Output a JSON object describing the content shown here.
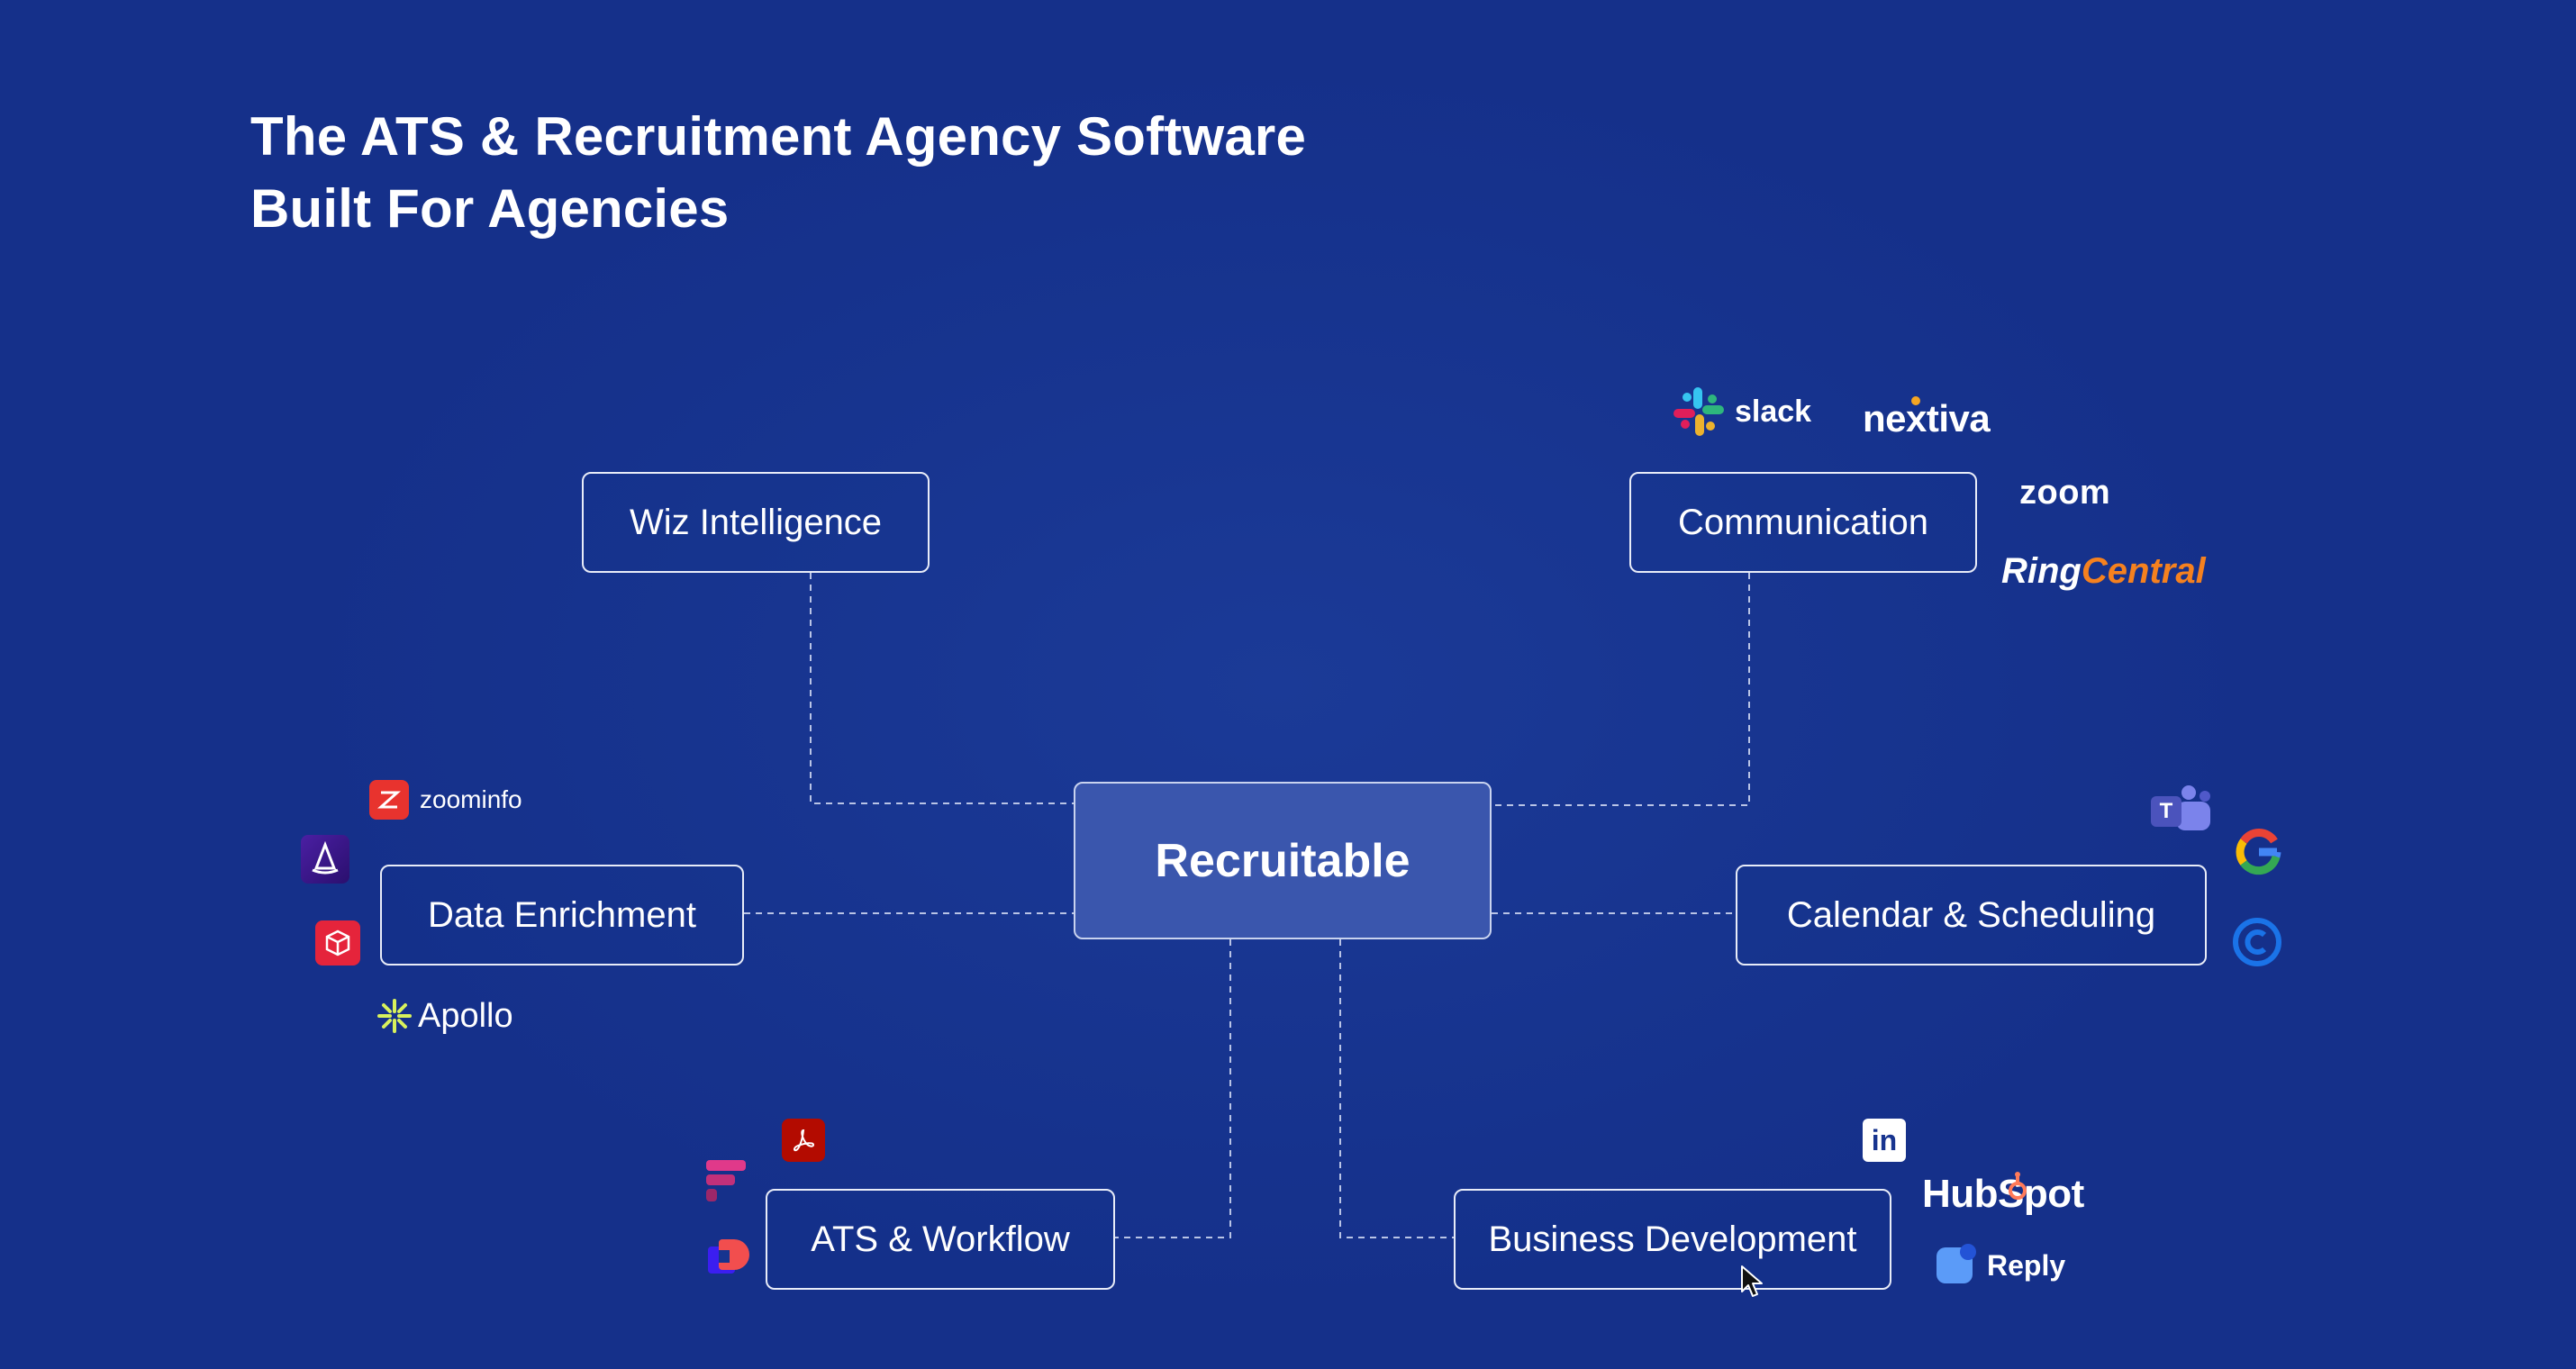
{
  "title": {
    "line1": "The ATS & Recruitment Agency Software",
    "line2": "Built For Agencies"
  },
  "center": {
    "label": "Recruitable"
  },
  "nodes": {
    "wiz": "Wiz Intelligence",
    "communication": "Communication",
    "data_enrichment": "Data Enrichment",
    "calendar": "Calendar & Scheduling",
    "ats": "ATS & Workflow",
    "bizdev": "Business Development"
  },
  "logos": {
    "slack": "slack",
    "nextiva": "nextiva",
    "zoom": "zoom",
    "ringcentral": {
      "ring": "Ring",
      "central": "Central"
    },
    "zoominfo": "zoominfo",
    "apollo": "Apollo",
    "teams_letter": "T",
    "hubspot": "HubSpot",
    "reply": "Reply",
    "linkedin": "in"
  },
  "colors": {
    "background": "#17348f",
    "center_fill": "#3a56ad",
    "connector": "#b9c4e6",
    "ringcentral_orange": "#f5811f",
    "zoominfo_red": "#e8332e",
    "apollo_yellow": "#d8f15c",
    "hubspot_orange": "#ff7a59"
  }
}
